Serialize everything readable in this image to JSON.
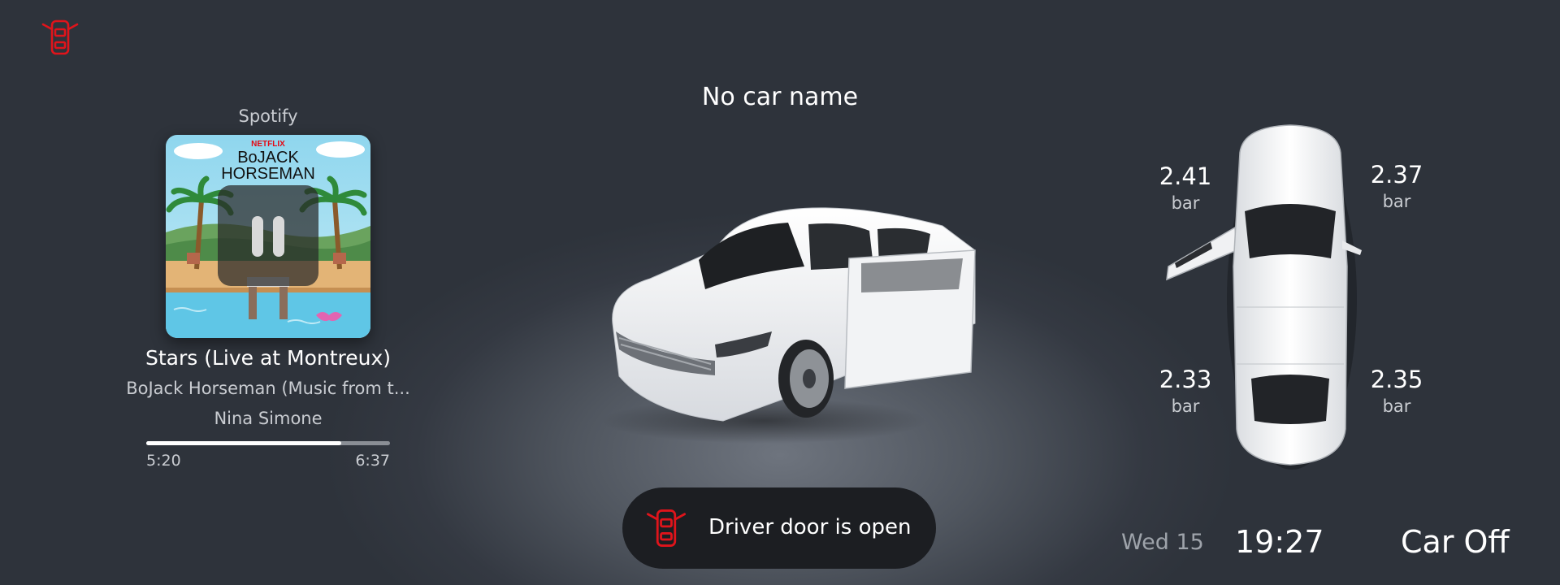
{
  "header": {
    "icon": "car-door-open-icon",
    "alert_color": "#e0141b"
  },
  "car": {
    "name": "No car name"
  },
  "media": {
    "source": "Spotify",
    "album_art_text": {
      "brand": "NETFLIX",
      "title_line1": "BoJACK",
      "title_line2": "HORSEMAN"
    },
    "playback_state": "paused",
    "title": "Stars (Live at Montreux)",
    "album": "BoJack Horseman (Music from t...",
    "artist": "Nina Simone",
    "elapsed": "5:20",
    "total": "6:37",
    "progress_fraction": 0.8
  },
  "alert": {
    "icon": "car-door-open-icon",
    "text": "Driver door is open"
  },
  "tires": {
    "front_left": {
      "value": "2.41",
      "unit": "bar"
    },
    "front_right": {
      "value": "2.37",
      "unit": "bar"
    },
    "rear_left": {
      "value": "2.33",
      "unit": "bar"
    },
    "rear_right": {
      "value": "2.35",
      "unit": "bar"
    }
  },
  "status": {
    "date": "Wed 15",
    "time": "19:27",
    "car_state": "Car Off"
  }
}
